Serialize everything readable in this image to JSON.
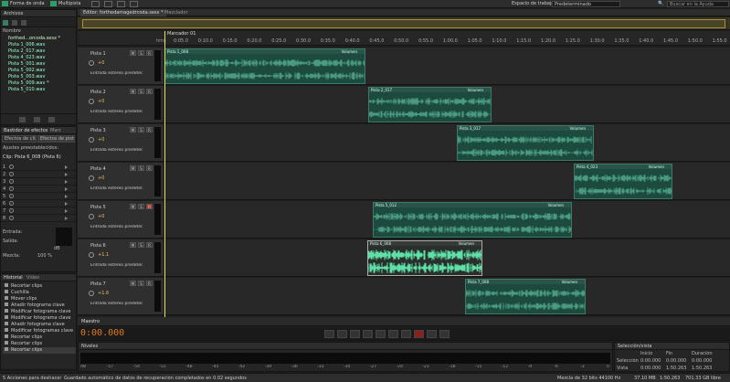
{
  "topbar": {
    "forma_onda": "Forma de onda",
    "multipista": "Multipista",
    "workspace_label": "Espacio de trabajo:",
    "workspace_value": "Predeterminado",
    "search_placeholder": "Buscar en la Ayuda"
  },
  "files_panel": {
    "title": "Archivos",
    "col_name": "Nombre",
    "files": [
      "forthed...orcoda.sesx *",
      "Pista 1_006.wav",
      "Pista 2_017.wav",
      "Pista 4_023.wav",
      "Pista 5_001.wav",
      "Pista 5_002.wav",
      "Pista 5_003.wav",
      "Pista 5_009.wav *",
      "Pista 5_010.wav"
    ]
  },
  "effects_panel": {
    "tabs": [
      "Bastidor de efectos",
      "Marc"
    ],
    "subtabs": [
      "Efectos de clip",
      "Efectos de pista"
    ],
    "preset_label": "Ajustes preestablecidos:",
    "clip_label": "Clip: Pista 6_008 (Pista 6)",
    "slots": [
      "1",
      "2",
      "3",
      "4",
      "5",
      "6",
      "7",
      "8"
    ],
    "entrada": "Entrada:",
    "salida": "Salida:",
    "mezcla": "Mezcla:",
    "mezcla_value": "100 %",
    "db_label": "dB"
  },
  "history_panel": {
    "tabs": [
      "Historial",
      "Vídeo"
    ],
    "items": [
      "Recortar clips",
      "Cuchilla",
      "Mover clips",
      "Añadir fotograma clave",
      "Modificar fotograma clave",
      "Modificar fotograma clave",
      "Añadir fotograma clave",
      "Modificar fotogramas clave",
      "Recortar clips",
      "Recortar clips",
      "Recortar clips"
    ],
    "undo_count": "5 Acciones para deshacer"
  },
  "editor": {
    "tab_title": "Editor: forthedamagedrcoda.sesx *",
    "mixer_tab": "Mezclador",
    "marker": "Marcador 01",
    "ruler_unit": "hms",
    "ruler_ticks": [
      "0:05.0",
      "0:10.0",
      "0:15.0",
      "0:20.0",
      "0:25.0",
      "0:30.0",
      "0:35.0",
      "0:40.0",
      "0:45.0",
      "0:50.0",
      "0:55.0",
      "1:00.0",
      "1:05.0",
      "1:10.0",
      "1:15.0",
      "1:20.0",
      "1:25.0",
      "1:30.0",
      "1:35.0",
      "1:40.0",
      "1:45.0",
      "1:50.0",
      "1:55.0"
    ],
    "input_label": "Entrada estéreo predeter.",
    "volume_label": "Volumen",
    "tracks": [
      {
        "name": "Pista 1",
        "value": "+0",
        "clips": [
          {
            "title": "Pista 1_008",
            "title2": "Pista 1_008"
          }
        ]
      },
      {
        "name": "Pista 2",
        "value": "+0",
        "clips": [
          {
            "title": "Pista 2_017"
          }
        ]
      },
      {
        "name": "Pista 3",
        "value": "+0",
        "clips": [
          {
            "title": "Pista 3_017"
          }
        ]
      },
      {
        "name": "Pista 4",
        "value": "+0",
        "clips": [
          {
            "title": "Pista 4_023"
          }
        ]
      },
      {
        "name": "Pista 5",
        "value": "+0",
        "clips": [
          {
            "title": "Pista 5_012"
          }
        ]
      },
      {
        "name": "Pista 6",
        "value": "+1.1",
        "clips": [
          {
            "title": "Pista 6_008"
          }
        ]
      },
      {
        "name": "Pista 7",
        "value": "+1.6",
        "clips": [
          {
            "title": "Pista 7_008"
          }
        ]
      }
    ],
    "master": "Maestro",
    "time": "0:00.000"
  },
  "levels_panel": {
    "title": "Niveles",
    "scale": [
      "dB",
      "-57",
      "-54",
      "-51",
      "-48",
      "-45",
      "-42",
      "-39",
      "-36",
      "-33",
      "-30",
      "-27",
      "-24",
      "-21",
      "-18",
      "-15",
      "-12",
      "-9",
      "-6",
      "-3",
      "0"
    ]
  },
  "selection_panel": {
    "title": "Selección/vista",
    "col_inicio": "Inicio",
    "col_fin": "Fin",
    "col_duracion": "Duración",
    "seleccion_label": "Selección",
    "vista_label": "Vista",
    "seleccion": [
      "0:00.000",
      "0:00.000",
      "0:00.000"
    ],
    "vista": [
      "0:00.000",
      "1:50.263",
      "1:50.263"
    ]
  },
  "statusbar": {
    "message": "Guardado automático de datos de recuperación completados en 0.02 segundos",
    "format": "Mezcla de 32 bits 44100 Hz",
    "size": "37.10 MB",
    "duration": "1:50.263",
    "free": "701.33 GB libre"
  },
  "colors": {
    "accent_green": "#2f9c6a",
    "clip_bg": "#1d4a3e",
    "playhead_yellow": "#e8e060",
    "time_orange": "#e07a20",
    "record_red": "#c0392b"
  }
}
